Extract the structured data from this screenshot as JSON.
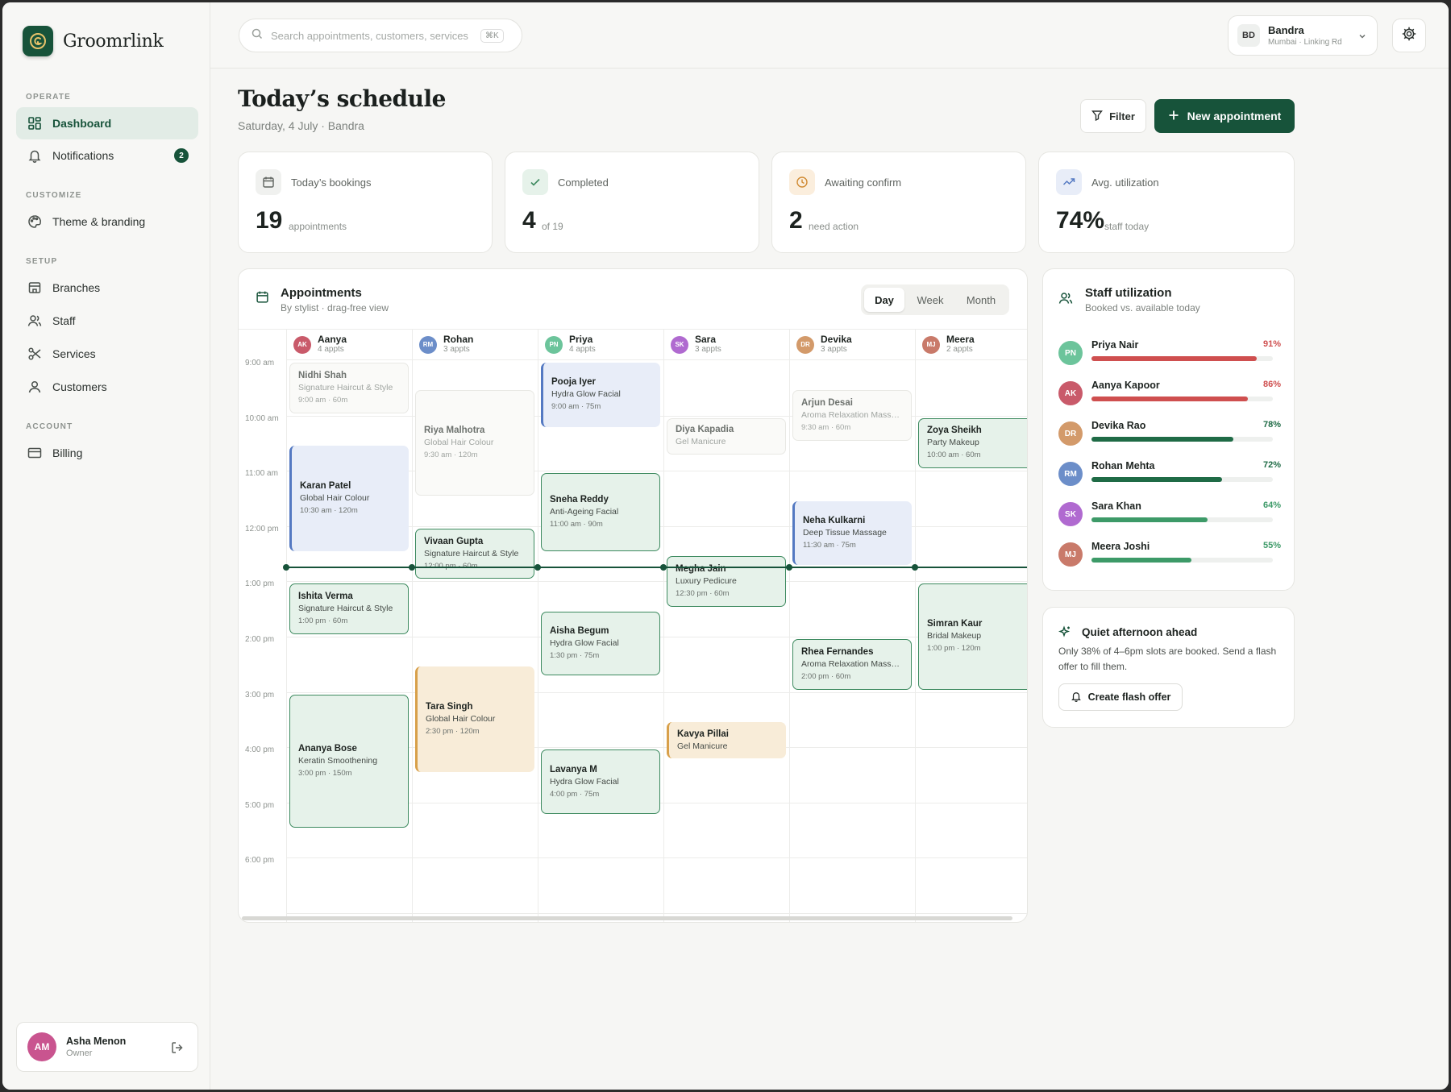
{
  "app": {
    "name": "Groomrlink"
  },
  "sidebar": {
    "sections": [
      {
        "title": "OPERATE"
      },
      {
        "title": "CUSTOMIZE"
      },
      {
        "title": "SETUP"
      },
      {
        "title": "ACCOUNT"
      }
    ],
    "items": [
      {
        "label": "Dashboard",
        "icon": "grid-icon"
      },
      {
        "label": "Notifications",
        "icon": "bell-icon",
        "badge": "2"
      },
      {
        "label": "Theme & branding",
        "icon": "palette-icon"
      },
      {
        "label": "Branches",
        "icon": "store-icon"
      },
      {
        "label": "Staff",
        "icon": "users-icon"
      },
      {
        "label": "Services",
        "icon": "scissors-icon"
      },
      {
        "label": "Customers",
        "icon": "user-icon"
      },
      {
        "label": "Billing",
        "icon": "card-icon"
      }
    ],
    "user": {
      "initials": "AM",
      "name": "Asha Menon",
      "role": "Owner",
      "color": "#c9548f"
    }
  },
  "topbar": {
    "search_placeholder": "Search appointments, customers, services",
    "shortcut": "⌘K",
    "branch": {
      "initials": "BD",
      "name": "Bandra",
      "location": "Mumbai · Linking Rd"
    }
  },
  "header": {
    "title": "Today’s schedule",
    "subtitle": "Saturday, 4 July · Bandra",
    "filter_label": "Filter",
    "new_label": "New appointment"
  },
  "stats": [
    {
      "label": "Today’s bookings",
      "value": "19",
      "unit": "appointments",
      "icon": "calendar-icon",
      "bg": "#f0f1ef",
      "fg": "#5e635f"
    },
    {
      "label": "Completed",
      "value": "4",
      "unit": "of 19",
      "icon": "check-icon",
      "bg": "#e6f2ea",
      "fg": "#3d8a5f"
    },
    {
      "label": "Awaiting confirm",
      "value": "2",
      "unit": "need action",
      "icon": "clock-icon",
      "bg": "#fbeedd",
      "fg": "#d08a32"
    },
    {
      "label": "Avg. utilization",
      "value": "74%",
      "unit": "staff today",
      "icon": "trend-icon",
      "bg": "#e8edf8",
      "fg": "#5479c2"
    }
  ],
  "appointments": {
    "title": "Appointments",
    "subtitle": "By stylist · drag-free view",
    "views": [
      "Day",
      "Week",
      "Month"
    ],
    "active_view": "Day",
    "times": [
      "9:00 am",
      "10:00 am",
      "11:00 am",
      "12:00 pm",
      "1:00 pm",
      "2:00 pm",
      "3:00 pm",
      "4:00 pm",
      "5:00 pm",
      "6:00 pm"
    ],
    "staff": [
      {
        "initials": "AK",
        "name": "Aanya",
        "count": "4 appts",
        "color": "#c95a6a"
      },
      {
        "initials": "RM",
        "name": "Rohan",
        "count": "3 appts",
        "color": "#6c8ec9"
      },
      {
        "initials": "PN",
        "name": "Priya",
        "count": "4 appts",
        "color": "#6cc49b"
      },
      {
        "initials": "SK",
        "name": "Sara",
        "count": "3 appts",
        "color": "#b06ad0"
      },
      {
        "initials": "DR",
        "name": "Devika",
        "count": "3 appts",
        "color": "#d39a6a"
      },
      {
        "initials": "MJ",
        "name": "Meera",
        "count": "2 appts",
        "color": "#c97a6a"
      }
    ],
    "items": [
      {
        "col": 0,
        "start": 9.0,
        "end": 10.0,
        "style": "ghost",
        "name": "Nidhi Shah",
        "service": "Signature Haircut & Style",
        "time": "9:00 am · 60m"
      },
      {
        "col": 0,
        "start": 10.5,
        "end": 12.5,
        "style": "blue",
        "name": "Karan Patel",
        "service": "Global Hair Colour",
        "time": "10:30 am · 120m"
      },
      {
        "col": 0,
        "start": 13.0,
        "end": 14.0,
        "style": "green",
        "name": "Ishita Verma",
        "service": "Signature Haircut & Style",
        "time": "1:00 pm · 60m"
      },
      {
        "col": 0,
        "start": 15.0,
        "end": 17.5,
        "style": "green",
        "name": "Ananya Bose",
        "service": "Keratin Smoothening",
        "time": "3:00 pm · 150m"
      },
      {
        "col": 1,
        "start": 9.5,
        "end": 11.5,
        "style": "ghost",
        "name": "Riya Malhotra",
        "service": "Global Hair Colour",
        "time": "9:30 am · 120m"
      },
      {
        "col": 1,
        "start": 12.0,
        "end": 13.0,
        "style": "green",
        "name": "Vivaan Gupta",
        "service": "Signature Haircut & Style",
        "time": "12:00 pm · 60m"
      },
      {
        "col": 1,
        "start": 14.5,
        "end": 16.5,
        "style": "amber",
        "name": "Tara Singh",
        "service": "Global Hair Colour",
        "time": "2:30 pm · 120m"
      },
      {
        "col": 2,
        "start": 9.0,
        "end": 10.25,
        "style": "blue",
        "name": "Pooja Iyer",
        "service": "Hydra Glow Facial",
        "time": "9:00 am · 75m"
      },
      {
        "col": 2,
        "start": 11.0,
        "end": 12.5,
        "style": "green",
        "name": "Sneha Reddy",
        "service": "Anti-Ageing Facial",
        "time": "11:00 am · 90m"
      },
      {
        "col": 2,
        "start": 13.5,
        "end": 14.75,
        "style": "green",
        "name": "Aisha Begum",
        "service": "Hydra Glow Facial",
        "time": "1:30 pm · 75m"
      },
      {
        "col": 2,
        "start": 16.0,
        "end": 17.25,
        "style": "green",
        "name": "Lavanya M",
        "service": "Hydra Glow Facial",
        "time": "4:00 pm · 75m"
      },
      {
        "col": 3,
        "start": 10.0,
        "end": 10.75,
        "style": "ghost",
        "name": "Diya Kapadia",
        "service": "Gel Manicure",
        "time": ""
      },
      {
        "col": 3,
        "start": 12.5,
        "end": 13.5,
        "style": "green",
        "name": "Megha Jain",
        "service": "Luxury Pedicure",
        "time": "12:30 pm · 60m"
      },
      {
        "col": 3,
        "start": 15.5,
        "end": 16.25,
        "style": "amber",
        "name": "Kavya Pillai",
        "service": "Gel Manicure",
        "time": ""
      },
      {
        "col": 4,
        "start": 9.5,
        "end": 10.5,
        "style": "ghost",
        "name": "Arjun Desai",
        "service": "Aroma Relaxation Massage",
        "time": "9:30 am · 60m"
      },
      {
        "col": 4,
        "start": 11.5,
        "end": 12.75,
        "style": "blue",
        "name": "Neha Kulkarni",
        "service": "Deep Tissue Massage",
        "time": "11:30 am · 75m"
      },
      {
        "col": 4,
        "start": 14.0,
        "end": 15.0,
        "style": "green",
        "name": "Rhea Fernandes",
        "service": "Aroma Relaxation Massage",
        "time": "2:00 pm · 60m"
      },
      {
        "col": 5,
        "start": 10.0,
        "end": 11.0,
        "style": "green",
        "name": "Zoya Sheikh",
        "service": "Party Makeup",
        "time": "10:00 am · 60m"
      },
      {
        "col": 5,
        "start": 13.0,
        "end": 15.0,
        "style": "green",
        "name": "Simran Kaur",
        "service": "Bridal Makeup",
        "time": "1:00 pm · 120m"
      }
    ],
    "now_hour": 12.75
  },
  "utilization": {
    "title": "Staff utilization",
    "subtitle": "Booked vs. available today",
    "rows": [
      {
        "initials": "PN",
        "name": "Priya Nair",
        "percent": 91,
        "label": "91%",
        "avatar": "#6cc49b",
        "bar": "#cf4f4f"
      },
      {
        "initials": "AK",
        "name": "Aanya Kapoor",
        "percent": 86,
        "label": "86%",
        "avatar": "#c95a6a",
        "bar": "#cf4f4f"
      },
      {
        "initials": "DR",
        "name": "Devika Rao",
        "percent": 78,
        "label": "78%",
        "avatar": "#d39a6a",
        "bar": "#1f6b46"
      },
      {
        "initials": "RM",
        "name": "Rohan Mehta",
        "percent": 72,
        "label": "72%",
        "avatar": "#6c8ec9",
        "bar": "#1f6b46"
      },
      {
        "initials": "SK",
        "name": "Sara Khan",
        "percent": 64,
        "label": "64%",
        "avatar": "#b06ad0",
        "bar": "#3d9a68"
      },
      {
        "initials": "MJ",
        "name": "Meera Joshi",
        "percent": 55,
        "label": "55%",
        "avatar": "#c97a6a",
        "bar": "#3d9a68"
      }
    ]
  },
  "quiet": {
    "title": "Quiet afternoon ahead",
    "body": "Only 38% of 4–6pm slots are booked. Send a flash offer to fill them.",
    "button": "Create flash offer"
  }
}
